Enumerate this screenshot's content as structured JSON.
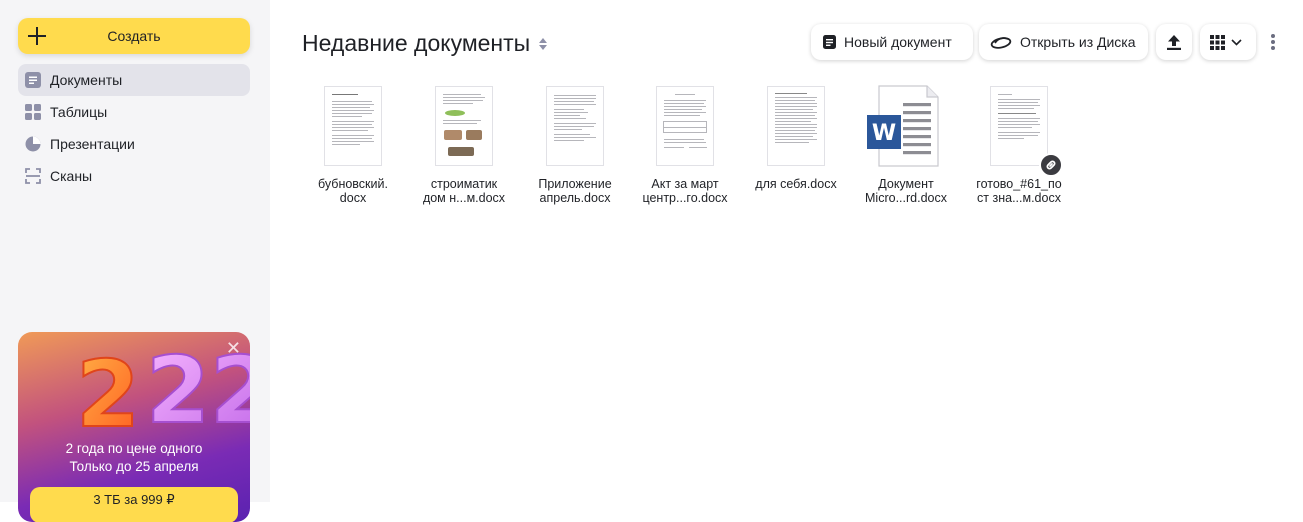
{
  "sidebar": {
    "create_label": "Создать",
    "items": [
      {
        "label": "Документы",
        "icon": "document-icon",
        "active": true
      },
      {
        "label": "Таблицы",
        "icon": "table-icon",
        "active": false
      },
      {
        "label": "Презентации",
        "icon": "presentation-icon",
        "active": false
      },
      {
        "label": "Сканы",
        "icon": "scan-icon",
        "active": false
      }
    ]
  },
  "promo": {
    "badge": "22",
    "line1": "2 года по цене одного",
    "line2": "Только до 25 апреля",
    "offer": "3 ТБ за 999 ₽"
  },
  "header": {
    "title": "Недавние документы",
    "new_doc": "Новый документ",
    "open_disk": "Открыть из Диска"
  },
  "files": [
    {
      "name_l1": "бубновский.",
      "name_l2": "docx",
      "thumb": "text"
    },
    {
      "name_l1": "строиматик",
      "name_l2": "дом н...м.docx",
      "thumb": "images"
    },
    {
      "name_l1": "Приложение",
      "name_l2": "апрель.docx",
      "thumb": "text"
    },
    {
      "name_l1": "Акт за март",
      "name_l2": "центр...го.docx",
      "thumb": "table"
    },
    {
      "name_l1": "для себя.docx",
      "name_l2": "",
      "thumb": "text"
    },
    {
      "name_l1": "Документ",
      "name_l2": "Micro...rd.docx",
      "thumb": "word"
    },
    {
      "name_l1": "готово_#61_по",
      "name_l2": "ст зна...м.docx",
      "thumb": "text",
      "shared": true
    }
  ],
  "colors": {
    "accent": "#ffdb4d",
    "sidebar_bg": "#f5f5f7",
    "word_blue": "#2b579a"
  }
}
